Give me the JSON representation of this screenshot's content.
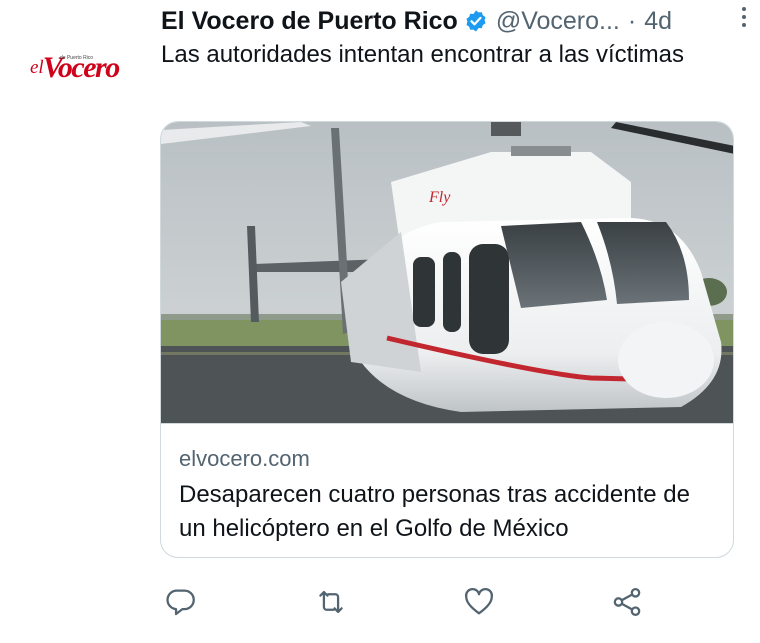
{
  "tweet": {
    "account_name": "El Vocero de Puerto Rico",
    "handle": "@Vocero...",
    "separator": "·",
    "time": "4d",
    "text": "Las autoridades intentan encontrar a las víctimas",
    "avatar": {
      "logo_prefix": "el",
      "logo_word": "Vocero",
      "logo_tagline": "de Puerto Rico"
    }
  },
  "card": {
    "domain": "elvocero.com",
    "headline": "Desaparecen cuatro personas tras accidente de un helicóptero en el Golfo de México",
    "image_icon": "helicopter-photo"
  },
  "actions": [
    {
      "name": "reply-icon"
    },
    {
      "name": "retweet-icon"
    },
    {
      "name": "like-icon"
    },
    {
      "name": "share-icon"
    }
  ],
  "colors": {
    "brand_red": "#d0021b",
    "verified_blue": "#1d9bf0",
    "text_primary": "#0f1419",
    "text_secondary": "#536471",
    "border": "#cfd9de"
  }
}
